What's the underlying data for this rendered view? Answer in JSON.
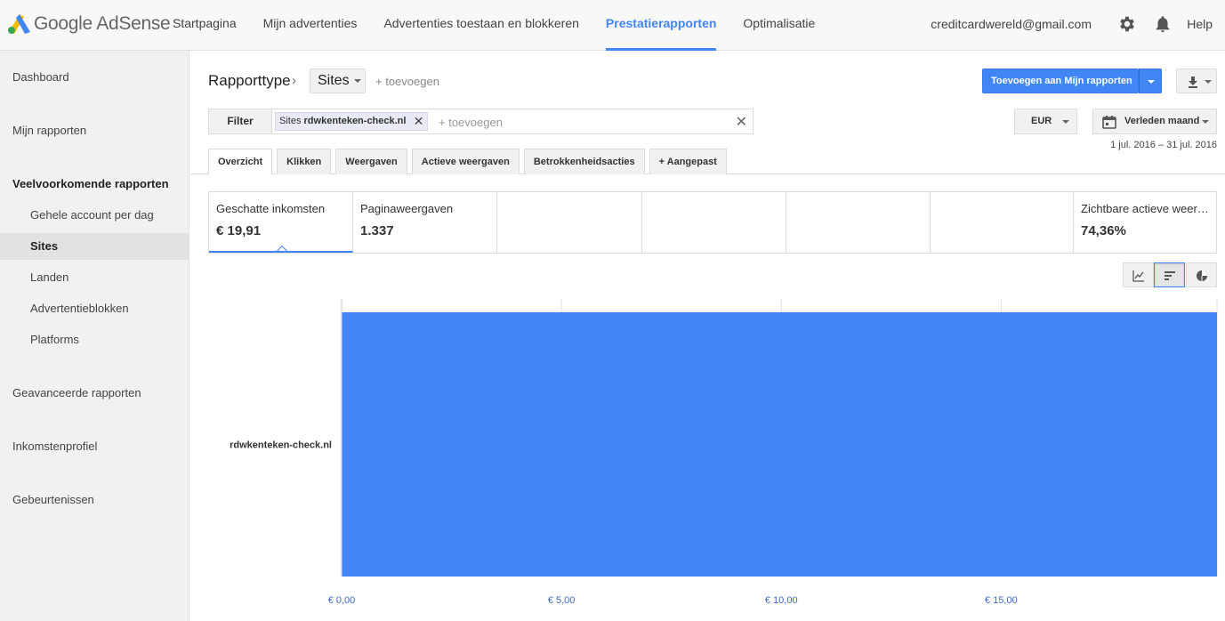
{
  "app": {
    "logo_text": "Google AdSense"
  },
  "nav": {
    "items": [
      {
        "label": "Startpagina",
        "active": false
      },
      {
        "label": "Mijn advertenties",
        "active": false
      },
      {
        "label": "Advertenties toestaan en blokkeren",
        "active": false
      },
      {
        "label": "Prestatierapporten",
        "active": true
      },
      {
        "label": "Optimalisatie",
        "active": false
      }
    ],
    "account": "creditcardwereld@gmail.com",
    "help": "Help",
    "icons": [
      "gear-icon",
      "bell-icon"
    ]
  },
  "sidebar": {
    "items": [
      {
        "label": "Dashboard"
      },
      {
        "label": "Mijn rapporten"
      },
      {
        "label": "Veelvoorkomende rapporten"
      },
      {
        "label": "Gehele account per dag"
      },
      {
        "label": "Sites"
      },
      {
        "label": "Landen"
      },
      {
        "label": "Advertentieblokken"
      },
      {
        "label": "Platforms"
      },
      {
        "label": "Geavanceerde rapporten"
      },
      {
        "label": "Inkomstenprofiel"
      },
      {
        "label": "Gebeurtenissen"
      }
    ],
    "selected": "Sites"
  },
  "header": {
    "report_type": "Rapporttype",
    "breadcrumb_arrow": "›",
    "dimension": "Sites",
    "add": "+ toevoegen",
    "add_to_reports": "Toevoegen aan Mijn rapporten"
  },
  "filter": {
    "label": "Filter",
    "chip_prefix": "Sites",
    "chip_value": "rdwkenteken-check.nl",
    "chip_remove": "✕",
    "placeholder": "+ toevoegen",
    "clear": "✕"
  },
  "currency": "EUR",
  "period": {
    "label": "Verleden maand",
    "range": "1 jul. 2016 – 31 jul. 2016"
  },
  "tabs": [
    {
      "label": "Overzicht",
      "active": true
    },
    {
      "label": "Klikken"
    },
    {
      "label": "Weergaven"
    },
    {
      "label": "Actieve weergaven"
    },
    {
      "label": "Betrokkenheidsacties"
    },
    {
      "label": "+  Aangepast"
    }
  ],
  "scorecards": [
    {
      "label": "Geschatte inkomsten",
      "value": "€ 19,91"
    },
    {
      "label": "Paginaweergaven",
      "value": "1.337"
    },
    {
      "label": "Zichtbare actieve weer…",
      "value": "74,36%"
    }
  ],
  "chart_toggles": [
    "line-chart-icon",
    "bar-chart-icon",
    "pie-chart-icon"
  ],
  "colors": {
    "accent": "#4285f4",
    "bar": "#4285f4"
  },
  "chart_data": {
    "type": "bar",
    "orientation": "horizontal",
    "categories": [
      "rdwkenteken-check.nl"
    ],
    "values": [
      19.91
    ],
    "xlim": [
      0,
      19.91
    ],
    "xticks": [
      0,
      5,
      10,
      15
    ],
    "xtick_labels": [
      "€ 0,00",
      "€ 5,00",
      "€ 10,00",
      "€ 15,00"
    ],
    "grid": true
  }
}
